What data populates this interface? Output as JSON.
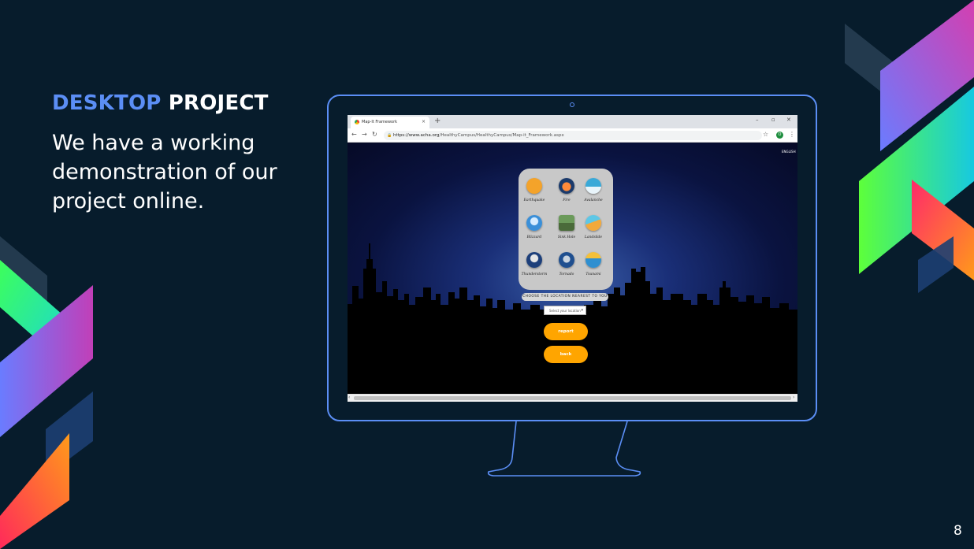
{
  "slide": {
    "title_accent": "DESKTOP",
    "title_main": "PROJECT",
    "body": "We have a working demonstration of our project online.",
    "page_number": "8"
  },
  "browser": {
    "tab_title": "Map-It Framework",
    "tab_close": "×",
    "new_tab": "+",
    "window_controls": [
      "–",
      "▫",
      "✕"
    ],
    "url_host": "https://www.acha.org",
    "url_path": "/HealthyCampus/HealthyCampus/Map-it_Framework.aspx",
    "profile_initial": "O"
  },
  "page": {
    "corner_tag": "ENGLISH",
    "disasters": [
      {
        "label": "Earthquake",
        "icon": "earthquake-icon",
        "color": "#f4a32a"
      },
      {
        "label": "Fire",
        "icon": "fire-icon",
        "color": "#1b3a6b"
      },
      {
        "label": "Avalanche",
        "icon": "avalanche-icon",
        "color": "#39a9d8"
      },
      {
        "label": "Blizzard",
        "icon": "blizzard-icon",
        "color": "#3a8fd8"
      },
      {
        "label": "Sink Hole",
        "icon": "sinkhole-icon",
        "color": "#6b9a5a"
      },
      {
        "label": "Landslide",
        "icon": "landslide-icon",
        "color": "#f2a93b"
      },
      {
        "label": "Thunderstorm",
        "icon": "thunderstorm-icon",
        "color": "#1d3f7a"
      },
      {
        "label": "Tornado",
        "icon": "tornado-icon",
        "color": "#1f4f8f"
      },
      {
        "label": "Tsunami",
        "icon": "tsunami-icon",
        "color": "#2f8fd0"
      }
    ],
    "choose_label": "CHOOSE THE LOCATION NEAREST TO YOU",
    "select_value": "Select your location",
    "report_label": "report",
    "back_label": "back"
  },
  "colors": {
    "background": "#071c2c",
    "accent_blue": "#5b8ef5",
    "button_orange": "#ffa500"
  }
}
